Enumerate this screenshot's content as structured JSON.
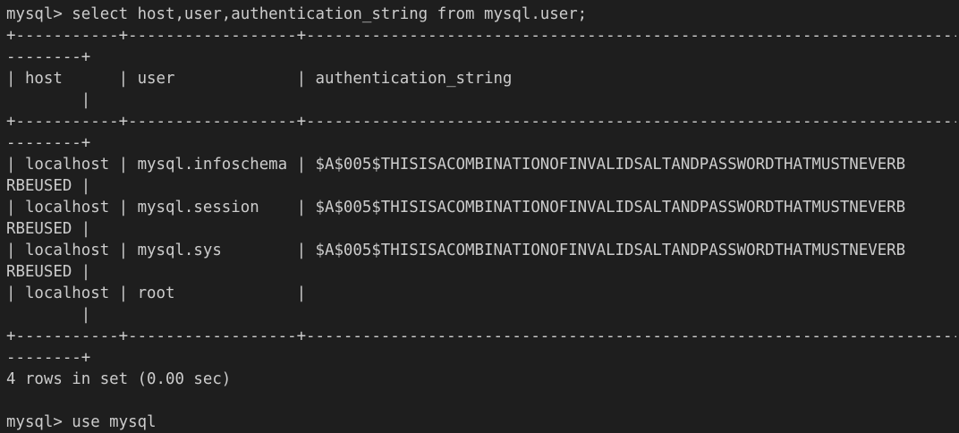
{
  "terminal": {
    "lines": [
      "mysql> select host,user,authentication_string from mysql.user;",
      "+-----------+------------------+------------------------------------------------------------------------",
      "--------+",
      "| host      | user             | authentication_string",
      "        |",
      "+-----------+------------------+------------------------------------------------------------------------",
      "--------+",
      "| localhost | mysql.infoschema | $A$005$THISISACOMBINATIONOFINVALIDSALTANDPASSWORDTHATMUSTNEVERB",
      "RBEUSED |",
      "| localhost | mysql.session    | $A$005$THISISACOMBINATIONOFINVALIDSALTANDPASSWORDTHATMUSTNEVERB",
      "RBEUSED |",
      "| localhost | mysql.sys        | $A$005$THISISACOMBINATIONOFINVALIDSALTANDPASSWORDTHATMUSTNEVERB",
      "RBEUSED |",
      "| localhost | root             |",
      "        |",
      "+-----------+------------------+------------------------------------------------------------------------",
      "--------+",
      "4 rows in set (0.00 sec)",
      "",
      "mysql> use mysql"
    ]
  },
  "colors": {
    "background": "#1e1e1e",
    "text": "#cccccc"
  }
}
